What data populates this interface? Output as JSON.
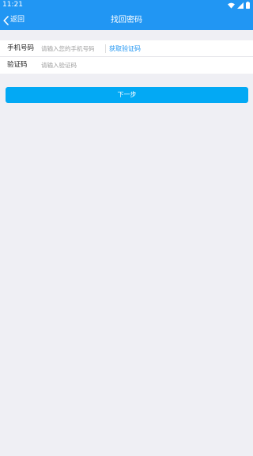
{
  "status_bar": {
    "time": "11:21",
    "icons": [
      "wifi-icon",
      "signal-icon",
      "battery-icon"
    ]
  },
  "header": {
    "back_label": "返回",
    "back_icon": "chevron-left-icon",
    "title": "找回密码",
    "background": "#2196f3"
  },
  "form": {
    "phone": {
      "label": "手机号码",
      "placeholder": "请输入您的手机号码",
      "value": ""
    },
    "get_code_label": "获取验证码",
    "code": {
      "label": "验证码",
      "placeholder": "请输入验证码",
      "value": ""
    }
  },
  "next_button": {
    "label": "下一步",
    "color": "#03a9f4"
  }
}
